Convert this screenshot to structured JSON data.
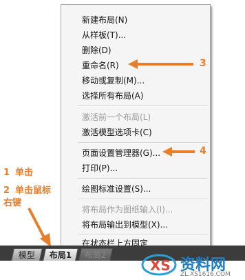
{
  "menu": {
    "items": [
      {
        "label": "新建布局(N)",
        "enabled": true
      },
      {
        "label": "从样板(T)...",
        "enabled": true
      },
      {
        "label": "删除(D)",
        "enabled": true
      },
      {
        "label": "重命名(R)",
        "enabled": true
      },
      {
        "label": "移动或复制(M)...",
        "enabled": true
      },
      {
        "label": "选择所有布局(A)",
        "enabled": true
      },
      {
        "label": "激活前一个布局(L)",
        "enabled": false
      },
      {
        "label": "激活模型选项卡(C)",
        "enabled": true
      },
      {
        "label": "页面设置管理器(G)...",
        "enabled": true
      },
      {
        "label": "打印(P)...",
        "enabled": true
      },
      {
        "label": "绘图标准设置(S)...",
        "enabled": true
      },
      {
        "label": "将布局作为图纸输入(I)...",
        "enabled": false
      },
      {
        "label": "将布局输出到模型(X)...",
        "enabled": true
      },
      {
        "label": "在状态栏上方固定",
        "enabled": true
      }
    ]
  },
  "annotations": {
    "step1_num": "1",
    "step1_text": "单击",
    "step2_num": "2",
    "step2_text": "单击鼠标",
    "step2_text2": "右键",
    "arrow3": "3",
    "arrow4": "4"
  },
  "tabs": {
    "model": "模型",
    "layout1": "布局1",
    "layout2": "布局2"
  },
  "watermark": {
    "brand": "资料网",
    "site": "ZL.XS1616.COM"
  },
  "colors": {
    "accent": "#e87d2a"
  }
}
